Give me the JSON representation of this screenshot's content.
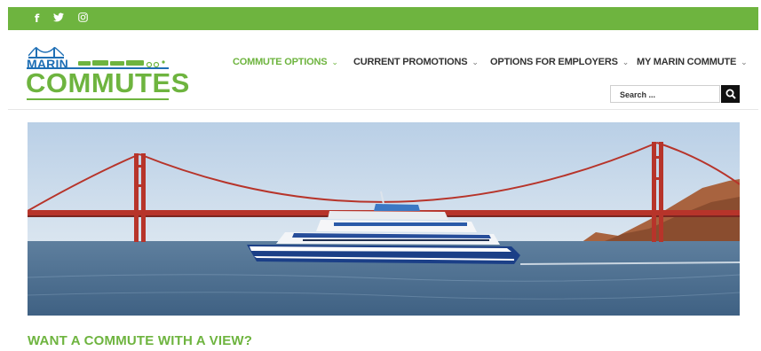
{
  "social": [
    {
      "name": "facebook-icon",
      "glyph": "f"
    },
    {
      "name": "twitter-icon",
      "glyph": "🐦"
    },
    {
      "name": "instagram-icon",
      "glyph": "◎"
    }
  ],
  "logo": {
    "top_text": "MARIN",
    "main_text": "COMMUTES"
  },
  "nav": {
    "items": [
      {
        "label": "COMMUTE OPTIONS",
        "active": true
      },
      {
        "label": "CURRENT PROMOTIONS",
        "active": false
      },
      {
        "label": "OPTIONS FOR EMPLOYERS",
        "active": false
      },
      {
        "label": "MY MARIN COMMUTE",
        "active": false
      }
    ],
    "chevron": "⌄"
  },
  "search": {
    "placeholder": "Search ..."
  },
  "hero": {
    "alt": "Ferry in front of the Golden Gate Bridge"
  },
  "main": {
    "headline": "WANT A COMMUTE WITH A VIEW?"
  },
  "colors": {
    "brand_green": "#6eb43f",
    "brand_blue": "#1f6fb5",
    "bridge_red": "#b7342a"
  }
}
